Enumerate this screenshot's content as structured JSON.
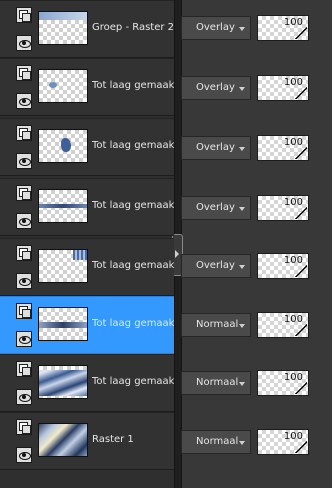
{
  "layers": [
    {
      "name": "Groep - Raster 2",
      "blend_mode": "Overlay",
      "opacity": "100",
      "selected": false,
      "thumb_icon": "group-gradient-thumbnail"
    },
    {
      "name": "Tot laag gemaakte se",
      "blend_mode": "Overlay",
      "opacity": "100",
      "selected": false,
      "thumb_icon": "small-blue-shape-thumbnail"
    },
    {
      "name": "Tot laag gemaakte se",
      "blend_mode": "Overlay",
      "opacity": "100",
      "selected": false,
      "thumb_icon": "blue-blob-thumbnail"
    },
    {
      "name": "Tot laag gemaakte se",
      "blend_mode": "Overlay",
      "opacity": "100",
      "selected": false,
      "thumb_icon": "horizontal-band-thumbnail"
    },
    {
      "name": "Tot laag gemaakte se",
      "blend_mode": "Overlay",
      "opacity": "100",
      "selected": false,
      "thumb_icon": "fringe-thumbnail"
    },
    {
      "name": "Tot laag gemaakte se",
      "blend_mode": "Normaal",
      "opacity": "100",
      "selected": true,
      "thumb_icon": "dark-band-thumbnail"
    },
    {
      "name": "Tot laag gemaakte se",
      "blend_mode": "Normaal",
      "opacity": "100",
      "selected": false,
      "thumb_icon": "wavy-blue-thumbnail"
    },
    {
      "name": "Raster 1",
      "blend_mode": "Normaal",
      "opacity": "100",
      "selected": false,
      "thumb_icon": "diagonal-gradient-thumbnail"
    }
  ],
  "colors": {
    "selected_row": "#3399ff",
    "panel_bg": "#3b3b3b"
  }
}
